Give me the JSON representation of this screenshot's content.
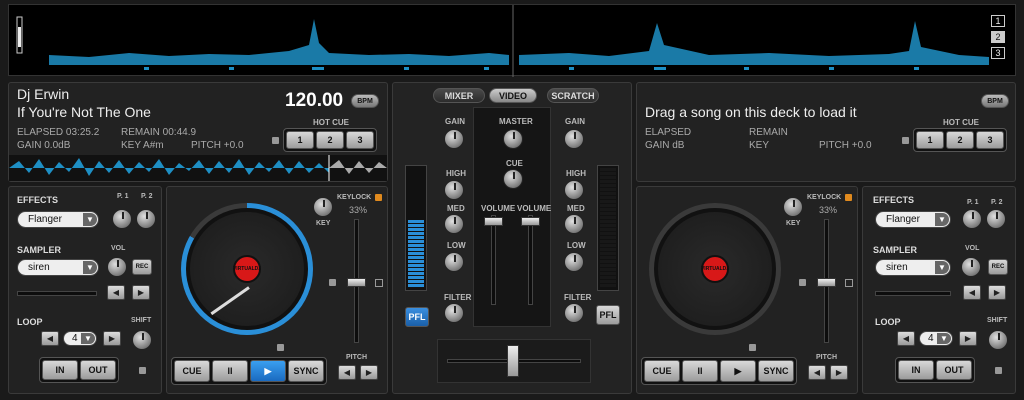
{
  "overview": {
    "deck_numbers": [
      "1",
      "2",
      "3"
    ],
    "selected_deck": "2"
  },
  "left_deck": {
    "artist": "Dj Erwin",
    "title": "If You're Not The One",
    "bpm": "120.00",
    "bpm_label": "BPM",
    "elapsed": "ELAPSED 03:25.2",
    "remain": "REMAIN 00:44.9",
    "gain": "GAIN 0.0dB",
    "key": "KEY A#m",
    "pitch": "PITCH +0.0",
    "hot_cue_label": "HOT CUE",
    "hot_cues": [
      "1",
      "2",
      "3"
    ],
    "effects_label": "EFFECTS",
    "p1": "P. 1",
    "p2": "P. 2",
    "effect_value": "Flanger",
    "sampler_label": "SAMPLER",
    "vol_label": "VOL",
    "sampler_value": "siren",
    "rec_label": "REC",
    "loop_label": "LOOP",
    "shift_label": "SHIFT",
    "loop_value": "4",
    "in_label": "IN",
    "out_label": "OUT",
    "key_label": "KEY",
    "keylock_label": "KEYLOCK",
    "keylock_value": "33%",
    "pitch_label": "PITCH",
    "transport": [
      "CUE",
      "II",
      "▶",
      "SYNC"
    ],
    "platter_logo": "VIRTUALDJ"
  },
  "mixer": {
    "tabs": [
      "MIXER",
      "VIDEO",
      "SCRATCH"
    ],
    "active_tab": "VIDEO",
    "gain": "GAIN",
    "master": "MASTER",
    "cue": "CUE",
    "high": "HIGH",
    "med": "MED",
    "low": "LOW",
    "filter": "FILTER",
    "volume": "VOLUME",
    "pfl": "PFL",
    "left_meter_level": 0.55
  },
  "right_deck": {
    "title": "Drag a song on this deck to load it",
    "bpm_label": "BPM",
    "elapsed": "ELAPSED",
    "remain": "REMAIN",
    "gain": "GAIN dB",
    "key": "KEY",
    "pitch": "PITCH +0.0",
    "hot_cue_label": "HOT CUE",
    "hot_cues": [
      "1",
      "2",
      "3"
    ],
    "effects_label": "EFFECTS",
    "p1": "P. 1",
    "p2": "P. 2",
    "effect_value": "Flanger",
    "sampler_label": "SAMPLER",
    "vol_label": "VOL",
    "sampler_value": "siren",
    "rec_label": "REC",
    "loop_label": "LOOP",
    "shift_label": "SHIFT",
    "loop_value": "4",
    "in_label": "IN",
    "out_label": "OUT",
    "key_label": "KEY",
    "keylock_label": "KEYLOCK",
    "keylock_value": "33%",
    "pitch_label": "PITCH",
    "transport": [
      "CUE",
      "II",
      "▶",
      "SYNC"
    ],
    "platter_logo": "VIRTUALDJ"
  },
  "colors": {
    "accent": "#2a8fd8",
    "waveform": "#1e8fc4",
    "play_active": "#1e7fd8",
    "logo_red": "#d81818"
  }
}
